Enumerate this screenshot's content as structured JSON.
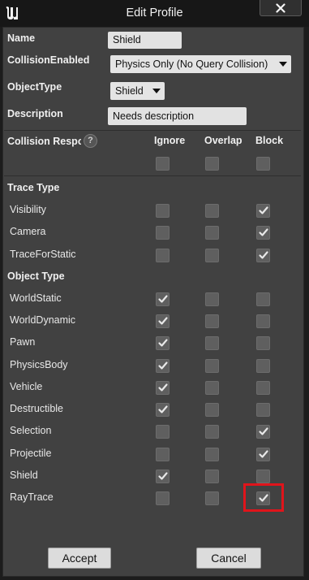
{
  "window": {
    "title": "Edit Profile"
  },
  "fields": {
    "name_label": "Name",
    "name_value": "Shield",
    "collision_enabled_label": "CollisionEnabled",
    "collision_enabled_value": "Physics Only (No Query Collision)",
    "object_type_label": "ObjectType",
    "object_type_value": "Shield",
    "description_label": "Description",
    "description_value": "Needs description"
  },
  "responses": {
    "header_label": "Collision Respor",
    "columns": [
      "Ignore",
      "Overlap",
      "Block"
    ],
    "all_checks": [
      false,
      false,
      false
    ]
  },
  "trace_type": {
    "label": "Trace Type",
    "rows": [
      {
        "name": "Visibility",
        "checks": [
          false,
          false,
          true
        ]
      },
      {
        "name": "Camera",
        "checks": [
          false,
          false,
          true
        ]
      },
      {
        "name": "TraceForStatic",
        "checks": [
          false,
          false,
          true
        ]
      }
    ]
  },
  "object_type": {
    "label": "Object Type",
    "rows": [
      {
        "name": "WorldStatic",
        "checks": [
          true,
          false,
          false
        ]
      },
      {
        "name": "WorldDynamic",
        "checks": [
          true,
          false,
          false
        ]
      },
      {
        "name": "Pawn",
        "checks": [
          true,
          false,
          false
        ]
      },
      {
        "name": "PhysicsBody",
        "checks": [
          true,
          false,
          false
        ]
      },
      {
        "name": "Vehicle",
        "checks": [
          true,
          false,
          false
        ]
      },
      {
        "name": "Destructible",
        "checks": [
          true,
          false,
          false
        ]
      },
      {
        "name": "Selection",
        "checks": [
          false,
          false,
          true
        ]
      },
      {
        "name": "Projectile",
        "checks": [
          false,
          false,
          true
        ]
      },
      {
        "name": "Shield",
        "checks": [
          true,
          false,
          false
        ]
      },
      {
        "name": "RayTrace",
        "checks": [
          false,
          false,
          true
        ]
      }
    ]
  },
  "buttons": {
    "accept": "Accept",
    "cancel": "Cancel"
  },
  "colors": {
    "highlight": "#e0141b",
    "panel": "#414141",
    "checkbox": "#5f5f5f"
  }
}
